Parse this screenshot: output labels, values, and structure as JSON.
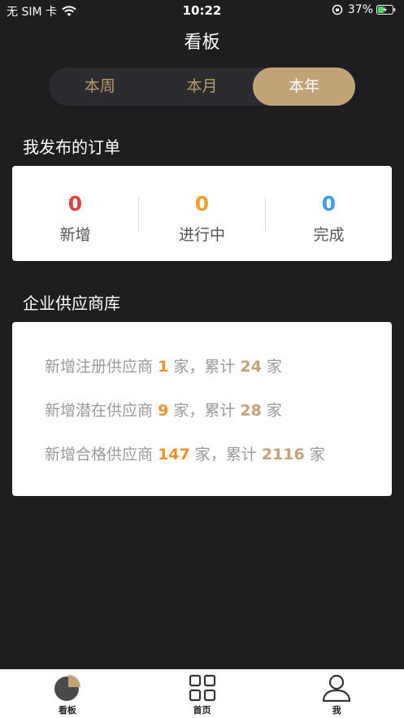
{
  "status_bar": {
    "carrier": "无 SIM 卡",
    "time": "10:22",
    "battery": "37%"
  },
  "nav": {
    "title": "看板"
  },
  "segment": {
    "items": [
      "本周",
      "本月",
      "本年"
    ],
    "active_index": 2
  },
  "orders": {
    "title": "我发布的订单",
    "stats": [
      {
        "value": "0",
        "label": "新增",
        "color": "#e0413c"
      },
      {
        "value": "0",
        "label": "进行中",
        "color": "#f0a22b"
      },
      {
        "value": "0",
        "label": "完成",
        "color": "#3d9fe8"
      }
    ]
  },
  "suppliers": {
    "title": "企业供应商库",
    "lines": [
      {
        "prefix": "新增注册供应商",
        "new_count": "1",
        "mid": "家，累计",
        "total": "24",
        "suffix": "家"
      },
      {
        "prefix": "新增潜在供应商",
        "new_count": "9",
        "mid": "家，累计",
        "total": "28",
        "suffix": "家"
      },
      {
        "prefix": "新增合格供应商",
        "new_count": "147",
        "mid": "家，累计",
        "total": "2116",
        "suffix": "家"
      }
    ]
  },
  "tab_bar": {
    "tabs": [
      {
        "label": "看板",
        "icon": "pie-chart-icon"
      },
      {
        "label": "首页",
        "icon": "grid-icon"
      },
      {
        "label": "我",
        "icon": "user-icon"
      }
    ]
  },
  "colors": {
    "background": "#1e1e21",
    "accent_gold": "#c2a277",
    "orange": "#f0922b"
  }
}
